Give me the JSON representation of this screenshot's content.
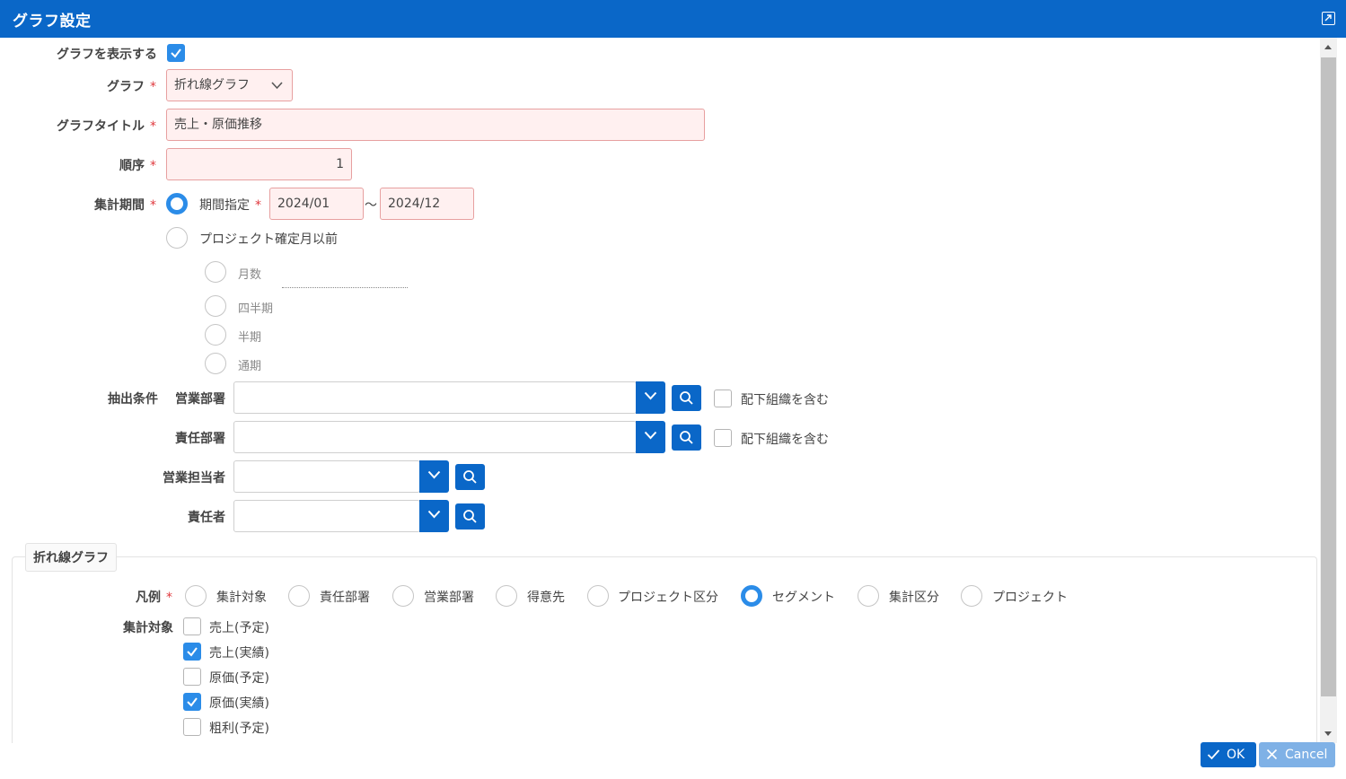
{
  "dialog": {
    "title": "グラフ設定"
  },
  "form": {
    "show_graph_label": "グラフを表示する",
    "graph_label": "グラフ",
    "graph_value": "折れ線グラフ",
    "graph_title_label": "グラフタイトル",
    "graph_title_value": "売上・原価推移",
    "order_label": "順序",
    "order_value": "1",
    "period_label": "集計期間",
    "period_specify_label": "期間指定",
    "period_from": "2024/01",
    "period_tilde": "〜",
    "period_to": "2024/12",
    "project_before_label": "プロジェクト確定月以前",
    "months_label": "月数",
    "quarter_label": "四半期",
    "half_label": "半期",
    "full_label": "通期",
    "extract_label": "抽出条件",
    "sales_dept_label": "営業部署",
    "resp_dept_label": "責任部署",
    "include_sub_label_1": "配下組織を含む",
    "include_sub_label_2": "配下組織を含む",
    "sales_person_label": "営業担当者",
    "resp_person_label": "責任者",
    "required_mark": "*"
  },
  "line_graph": {
    "section_title": "折れ線グラフ",
    "legend_label": "凡例",
    "legend_options": [
      "集計対象",
      "責任部署",
      "営業部署",
      "得意先",
      "プロジェクト区分",
      "セグメント",
      "集計区分",
      "プロジェクト"
    ],
    "legend_selected": "セグメント",
    "target_label": "集計対象",
    "targets": [
      {
        "label": "売上(予定)",
        "checked": false
      },
      {
        "label": "売上(実績)",
        "checked": true
      },
      {
        "label": "原価(予定)",
        "checked": false
      },
      {
        "label": "原価(実績)",
        "checked": true
      },
      {
        "label": "粗利(予定)",
        "checked": false
      }
    ]
  },
  "footer": {
    "ok_label": "OK",
    "cancel_label": "Cancel"
  },
  "colors": {
    "primary": "#0a67c8",
    "check": "#2b8ce8",
    "required": "#e0393e",
    "invalid_bg": "#fff0f0"
  }
}
